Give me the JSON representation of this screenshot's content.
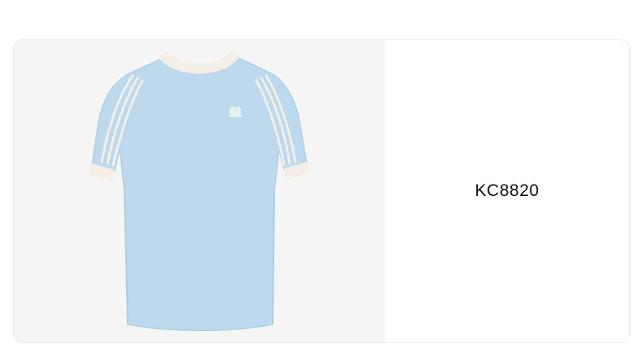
{
  "product": {
    "sku": "KC8820",
    "image_subject": "tshirt-icon",
    "colors": {
      "panel_background": "#f5f5f5",
      "garment": "#bcd9ee",
      "trim": "#f3efe6",
      "text": "#111111"
    }
  }
}
